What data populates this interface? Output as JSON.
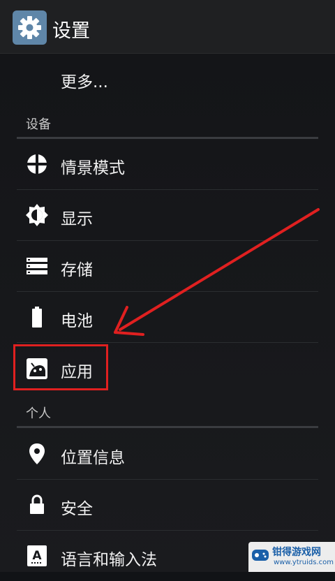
{
  "header": {
    "title": "设置",
    "icon": "gear-icon"
  },
  "items": {
    "more": "更多...",
    "scene_mode": "情景模式",
    "display": "显示",
    "storage": "存储",
    "battery": "电池",
    "apps": "应用",
    "location": "位置信息",
    "security": "安全",
    "language": "语言和输入法"
  },
  "categories": {
    "device": "设备",
    "personal": "个人"
  },
  "annotations": {
    "highlight_color": "#e02020",
    "arrow_color": "#e02020"
  },
  "watermark": {
    "name": "钳得游戏网",
    "url": "www.ytruids.com"
  }
}
